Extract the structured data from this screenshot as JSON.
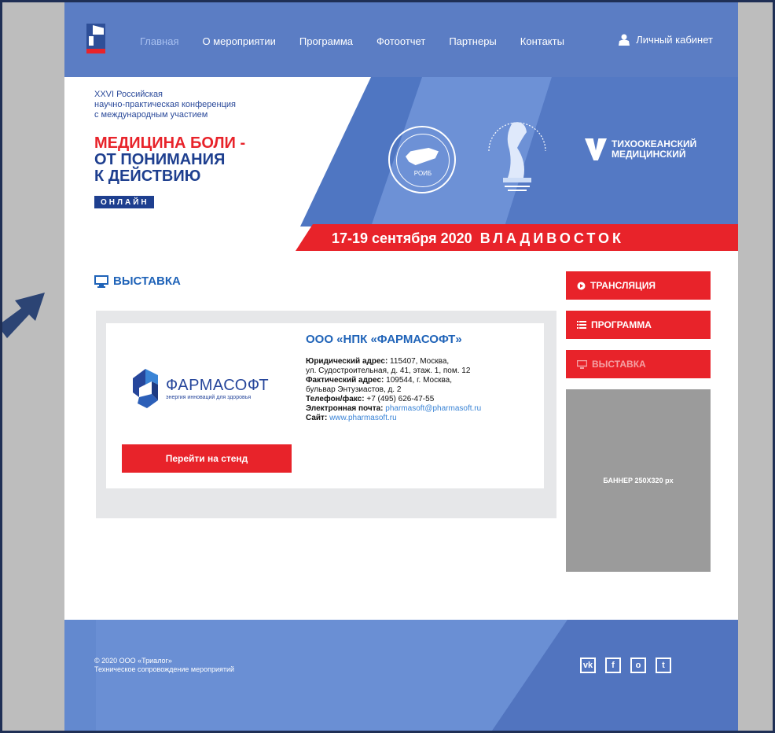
{
  "nav": {
    "links": [
      "Главная",
      "О мероприятии",
      "Программа",
      "Фотоотчет",
      "Партнеры",
      "Контакты"
    ],
    "cabinet": "Личный кабинет"
  },
  "hero": {
    "subtitle_lines": [
      "XXVI Российская",
      "научно-практическая конференция",
      "с международным участием"
    ],
    "title_red": "МЕДИЦИНА БОЛИ -",
    "title_blue_1": "ОТ ПОНИМАНИЯ",
    "title_blue_2": "К ДЕЙСТВИЮ",
    "badge": "ОНЛАЙН",
    "roib": "РОИБ",
    "tmu_1": "ТИХООКЕАНСКИЙ",
    "tmu_2": "МЕДИЦИНСКИЙ",
    "date": "17-19 сентября 2020",
    "city": "ВЛАДИВОСТОК"
  },
  "main": {
    "section_title": "ВЫСТАВКА",
    "company": "ООО «НПК «ФАРМАСОФТ»",
    "logo_name": "ФАРМАСОФТ",
    "logo_tagline": "энергия инноваций для здоровья",
    "legal_label": "Юридический адрес:",
    "legal_value": " 115407, Москва,",
    "legal_value_2": "ул. Судостроительная, д. 41, этаж. 1, пом. 12",
    "actual_label": "Фактический адрес:",
    "actual_value": " 109544, г. Москва,",
    "actual_value_2": "бульвар Энтузиастов, д. 2",
    "phone_label": "Телефон/факс:",
    "phone_value": " +7 (495) 626-47-55",
    "email_label": "Электронная почта:",
    "email_value": "pharmasoft@pharmasoft.ru",
    "site_label": "Сайт:",
    "site_value": "www.pharmasoft.ru",
    "go_button": "Перейти на стенд"
  },
  "sidebar": {
    "items": [
      {
        "label": "ТРАНСЛЯЦИЯ",
        "icon": "play-circle-icon"
      },
      {
        "label": "ПРОГРАММА",
        "icon": "list-icon"
      },
      {
        "label": "ВЫСТАВКА",
        "icon": "monitor-icon"
      }
    ],
    "banner": "БАННЕР 250Х320 px"
  },
  "footer": {
    "copyright": "© 2020 ООО «Триалог»",
    "support": "Техническое сопровождение мероприятий",
    "socials": [
      "vk-icon",
      "facebook-icon",
      "odnoklassniki-icon",
      "twitter-icon"
    ]
  },
  "colors": {
    "nav_blue": "#5b7dc4",
    "accent_red": "#e8232a",
    "title_blue": "#1f63b8"
  }
}
